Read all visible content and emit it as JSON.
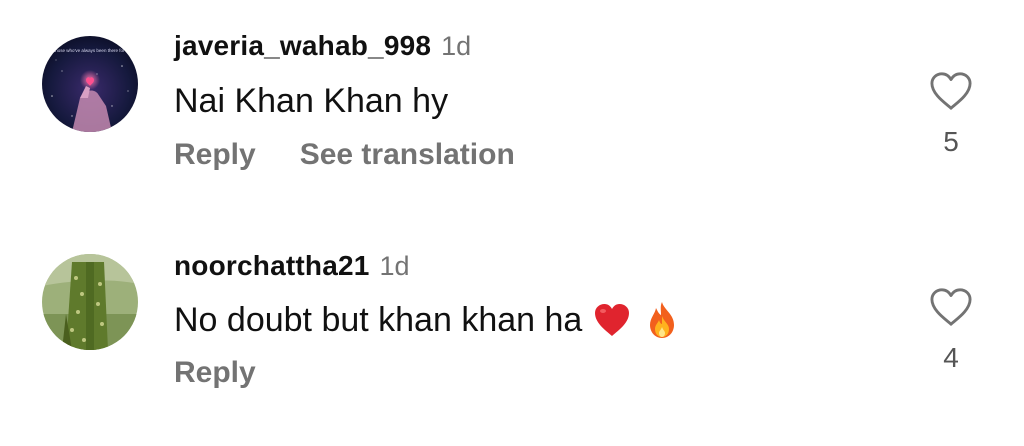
{
  "comments": [
    {
      "username": "javeria_wahab_998",
      "time": "1d",
      "text": "Nai Khan Khan hy",
      "actions": {
        "reply": "Reply",
        "translate": "See translation"
      },
      "likes": "5",
      "avatar_text": "To those who've always been there for me"
    },
    {
      "username": "noorchattha21",
      "time": "1d",
      "text": "No doubt but khan khan ha",
      "emojis": [
        "heart-emoji",
        "fire-emoji"
      ],
      "actions": {
        "reply": "Reply"
      },
      "likes": "4"
    }
  ],
  "icons": {
    "like": "heart-outline-icon"
  },
  "colors": {
    "primary_text": "#111111",
    "secondary_text": "#737373",
    "heart_red": "#e0242e"
  }
}
